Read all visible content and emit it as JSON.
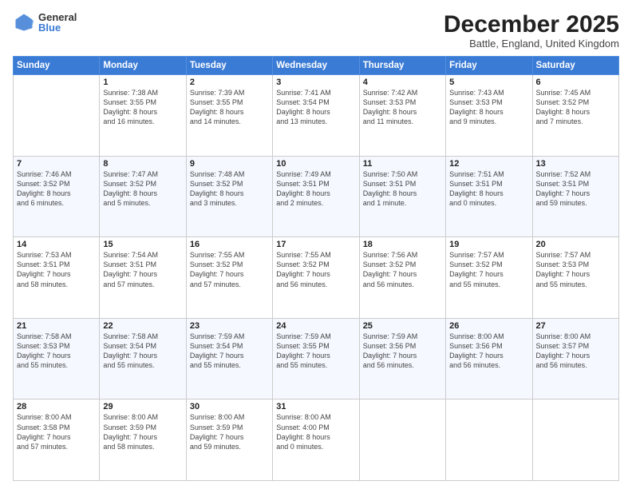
{
  "logo": {
    "general": "General",
    "blue": "Blue"
  },
  "header": {
    "title": "December 2025",
    "subtitle": "Battle, England, United Kingdom"
  },
  "days_of_week": [
    "Sunday",
    "Monday",
    "Tuesday",
    "Wednesday",
    "Thursday",
    "Friday",
    "Saturday"
  ],
  "weeks": [
    [
      {
        "day": "",
        "info": ""
      },
      {
        "day": "1",
        "info": "Sunrise: 7:38 AM\nSunset: 3:55 PM\nDaylight: 8 hours\nand 16 minutes."
      },
      {
        "day": "2",
        "info": "Sunrise: 7:39 AM\nSunset: 3:55 PM\nDaylight: 8 hours\nand 14 minutes."
      },
      {
        "day": "3",
        "info": "Sunrise: 7:41 AM\nSunset: 3:54 PM\nDaylight: 8 hours\nand 13 minutes."
      },
      {
        "day": "4",
        "info": "Sunrise: 7:42 AM\nSunset: 3:53 PM\nDaylight: 8 hours\nand 11 minutes."
      },
      {
        "day": "5",
        "info": "Sunrise: 7:43 AM\nSunset: 3:53 PM\nDaylight: 8 hours\nand 9 minutes."
      },
      {
        "day": "6",
        "info": "Sunrise: 7:45 AM\nSunset: 3:52 PM\nDaylight: 8 hours\nand 7 minutes."
      }
    ],
    [
      {
        "day": "7",
        "info": "Sunrise: 7:46 AM\nSunset: 3:52 PM\nDaylight: 8 hours\nand 6 minutes."
      },
      {
        "day": "8",
        "info": "Sunrise: 7:47 AM\nSunset: 3:52 PM\nDaylight: 8 hours\nand 5 minutes."
      },
      {
        "day": "9",
        "info": "Sunrise: 7:48 AM\nSunset: 3:52 PM\nDaylight: 8 hours\nand 3 minutes."
      },
      {
        "day": "10",
        "info": "Sunrise: 7:49 AM\nSunset: 3:51 PM\nDaylight: 8 hours\nand 2 minutes."
      },
      {
        "day": "11",
        "info": "Sunrise: 7:50 AM\nSunset: 3:51 PM\nDaylight: 8 hours\nand 1 minute."
      },
      {
        "day": "12",
        "info": "Sunrise: 7:51 AM\nSunset: 3:51 PM\nDaylight: 8 hours\nand 0 minutes."
      },
      {
        "day": "13",
        "info": "Sunrise: 7:52 AM\nSunset: 3:51 PM\nDaylight: 7 hours\nand 59 minutes."
      }
    ],
    [
      {
        "day": "14",
        "info": "Sunrise: 7:53 AM\nSunset: 3:51 PM\nDaylight: 7 hours\nand 58 minutes."
      },
      {
        "day": "15",
        "info": "Sunrise: 7:54 AM\nSunset: 3:51 PM\nDaylight: 7 hours\nand 57 minutes."
      },
      {
        "day": "16",
        "info": "Sunrise: 7:55 AM\nSunset: 3:52 PM\nDaylight: 7 hours\nand 57 minutes."
      },
      {
        "day": "17",
        "info": "Sunrise: 7:55 AM\nSunset: 3:52 PM\nDaylight: 7 hours\nand 56 minutes."
      },
      {
        "day": "18",
        "info": "Sunrise: 7:56 AM\nSunset: 3:52 PM\nDaylight: 7 hours\nand 56 minutes."
      },
      {
        "day": "19",
        "info": "Sunrise: 7:57 AM\nSunset: 3:52 PM\nDaylight: 7 hours\nand 55 minutes."
      },
      {
        "day": "20",
        "info": "Sunrise: 7:57 AM\nSunset: 3:53 PM\nDaylight: 7 hours\nand 55 minutes."
      }
    ],
    [
      {
        "day": "21",
        "info": "Sunrise: 7:58 AM\nSunset: 3:53 PM\nDaylight: 7 hours\nand 55 minutes."
      },
      {
        "day": "22",
        "info": "Sunrise: 7:58 AM\nSunset: 3:54 PM\nDaylight: 7 hours\nand 55 minutes."
      },
      {
        "day": "23",
        "info": "Sunrise: 7:59 AM\nSunset: 3:54 PM\nDaylight: 7 hours\nand 55 minutes."
      },
      {
        "day": "24",
        "info": "Sunrise: 7:59 AM\nSunset: 3:55 PM\nDaylight: 7 hours\nand 55 minutes."
      },
      {
        "day": "25",
        "info": "Sunrise: 7:59 AM\nSunset: 3:56 PM\nDaylight: 7 hours\nand 56 minutes."
      },
      {
        "day": "26",
        "info": "Sunrise: 8:00 AM\nSunset: 3:56 PM\nDaylight: 7 hours\nand 56 minutes."
      },
      {
        "day": "27",
        "info": "Sunrise: 8:00 AM\nSunset: 3:57 PM\nDaylight: 7 hours\nand 56 minutes."
      }
    ],
    [
      {
        "day": "28",
        "info": "Sunrise: 8:00 AM\nSunset: 3:58 PM\nDaylight: 7 hours\nand 57 minutes."
      },
      {
        "day": "29",
        "info": "Sunrise: 8:00 AM\nSunset: 3:59 PM\nDaylight: 7 hours\nand 58 minutes."
      },
      {
        "day": "30",
        "info": "Sunrise: 8:00 AM\nSunset: 3:59 PM\nDaylight: 7 hours\nand 59 minutes."
      },
      {
        "day": "31",
        "info": "Sunrise: 8:00 AM\nSunset: 4:00 PM\nDaylight: 8 hours\nand 0 minutes."
      },
      {
        "day": "",
        "info": ""
      },
      {
        "day": "",
        "info": ""
      },
      {
        "day": "",
        "info": ""
      }
    ]
  ]
}
